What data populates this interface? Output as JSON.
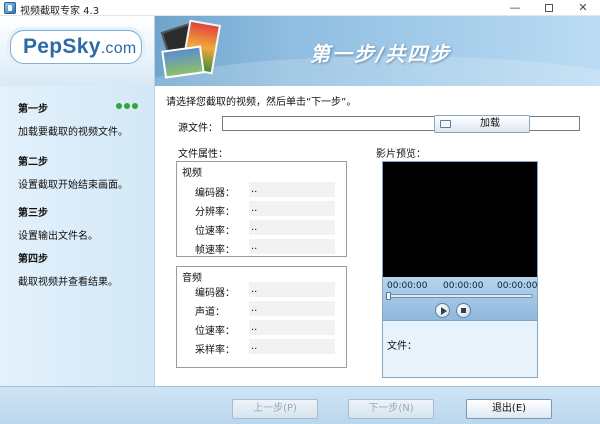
{
  "window": {
    "title": "视频截取专家 4.3",
    "minimize_glyph": "—",
    "close_glyph": "✕"
  },
  "header": {
    "logo_main": "PepSky",
    "logo_suffix": ".com",
    "step_title": "第一步/共四步"
  },
  "sidebar": {
    "steps": [
      {
        "name": "第一步",
        "desc": "加载要截取的视频文件。"
      },
      {
        "name": "第二步",
        "desc": "设置截取开始结束画面。"
      },
      {
        "name": "第三步",
        "desc": "设置输出文件名。"
      },
      {
        "name": "第四步",
        "desc": "截取视频并查看结果。"
      }
    ],
    "active_step_indicator_color": "#2fa53a"
  },
  "main": {
    "instruction": "请选择您截取的视频，然后单击“下一步”。",
    "source": {
      "label": "源文件：",
      "value": "",
      "load_button": "加载"
    },
    "props_label": "文件属性：",
    "video": {
      "title": "视频",
      "rows": [
        {
          "name": "编码器：",
          "value": ".."
        },
        {
          "name": "分辨率：",
          "value": ".."
        },
        {
          "name": "位速率：",
          "value": ".."
        },
        {
          "name": "帧速率：",
          "value": ".."
        }
      ]
    },
    "audio": {
      "title": "音频",
      "rows": [
        {
          "name": "编码器：",
          "value": ".."
        },
        {
          "name": "声道：",
          "value": ".."
        },
        {
          "name": "位速率：",
          "value": ".."
        },
        {
          "name": "采样率：",
          "value": ".."
        }
      ]
    },
    "preview": {
      "label": "影片预览：",
      "time_start": "00:00:00",
      "time_current": "00:00:00",
      "time_end": "00:00:00",
      "file_label": "文件："
    }
  },
  "footer": {
    "prev": "上一步(P)",
    "next": "下一步(N)",
    "exit": "退出(E)"
  }
}
